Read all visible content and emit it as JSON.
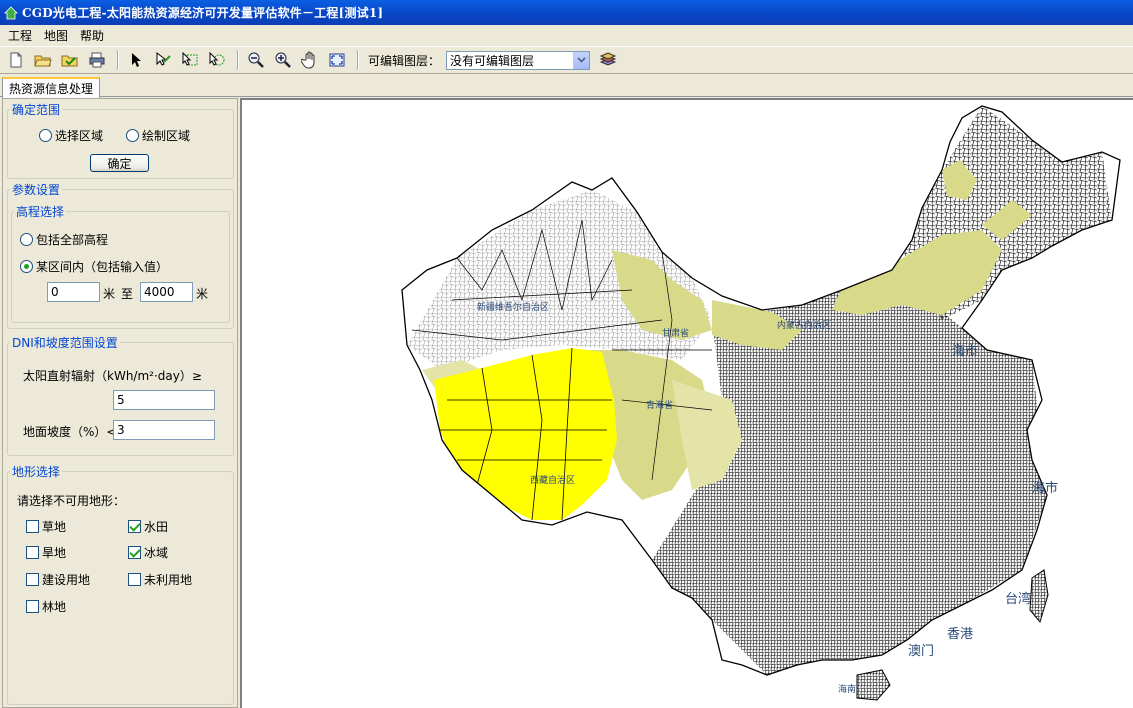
{
  "window": {
    "title": "CGD光电工程-太阳能热资源经济可开发量评估软件－工程[测试1]"
  },
  "menu": [
    "工程",
    "地图",
    "帮助"
  ],
  "toolbar": {
    "layer_label": "可编辑图层：",
    "layer_value": "没有可编辑图层",
    "icons": [
      "new-file-icon",
      "open-folder-icon",
      "open-project-icon",
      "print-icon",
      "select-arrow-icon",
      "select-feature-icon",
      "select-region-icon",
      "select-by-point-icon",
      "zoom-out-icon",
      "zoom-in-icon",
      "pan-hand-icon",
      "full-extent-icon",
      "layers-icon"
    ]
  },
  "tabs": [
    {
      "label": "热资源信息处理"
    }
  ],
  "panel": {
    "scope": {
      "legend": "确定范围",
      "option_select": "选择区域",
      "option_draw": "绘制区域",
      "confirm": "确定"
    },
    "params_legend": "参数设置",
    "elevation": {
      "legend": "高程选择",
      "option_all": "包括全部高程",
      "option_range": "某区间内（包括输入值）",
      "min": "0",
      "unit1": "米",
      "to": "至",
      "max": "4000",
      "unit2": "米",
      "selected": "option_range"
    },
    "dni": {
      "legend": "DNI和坡度范围设置",
      "dni_label": "太阳直射辐射（kWh/m²·day）≥",
      "dni_value": "5",
      "slope_label": "地面坡度（%）<",
      "slope_value": "3"
    },
    "terrain": {
      "legend": "地形选择",
      "prompt": "请选择不可用地形：",
      "items": [
        {
          "label": "草地",
          "checked": false
        },
        {
          "label": "水田",
          "checked": true
        },
        {
          "label": "旱地",
          "checked": false
        },
        {
          "label": "冰域",
          "checked": true
        },
        {
          "label": "建设用地",
          "checked": false
        },
        {
          "label": "未利用地",
          "checked": false
        },
        {
          "label": "林地",
          "checked": false
        }
      ]
    }
  },
  "map": {
    "labels": [
      "新疆维吾尔自治区",
      "甘肃省",
      "内蒙古自治区",
      "海市",
      "青海省",
      "西藏自治区",
      "海市",
      "台湾",
      "香港",
      "澳门",
      "海南"
    ],
    "colors": {
      "highlight": "#ffff00",
      "candidate": "#d9d98a",
      "boundary": "#000000"
    }
  }
}
